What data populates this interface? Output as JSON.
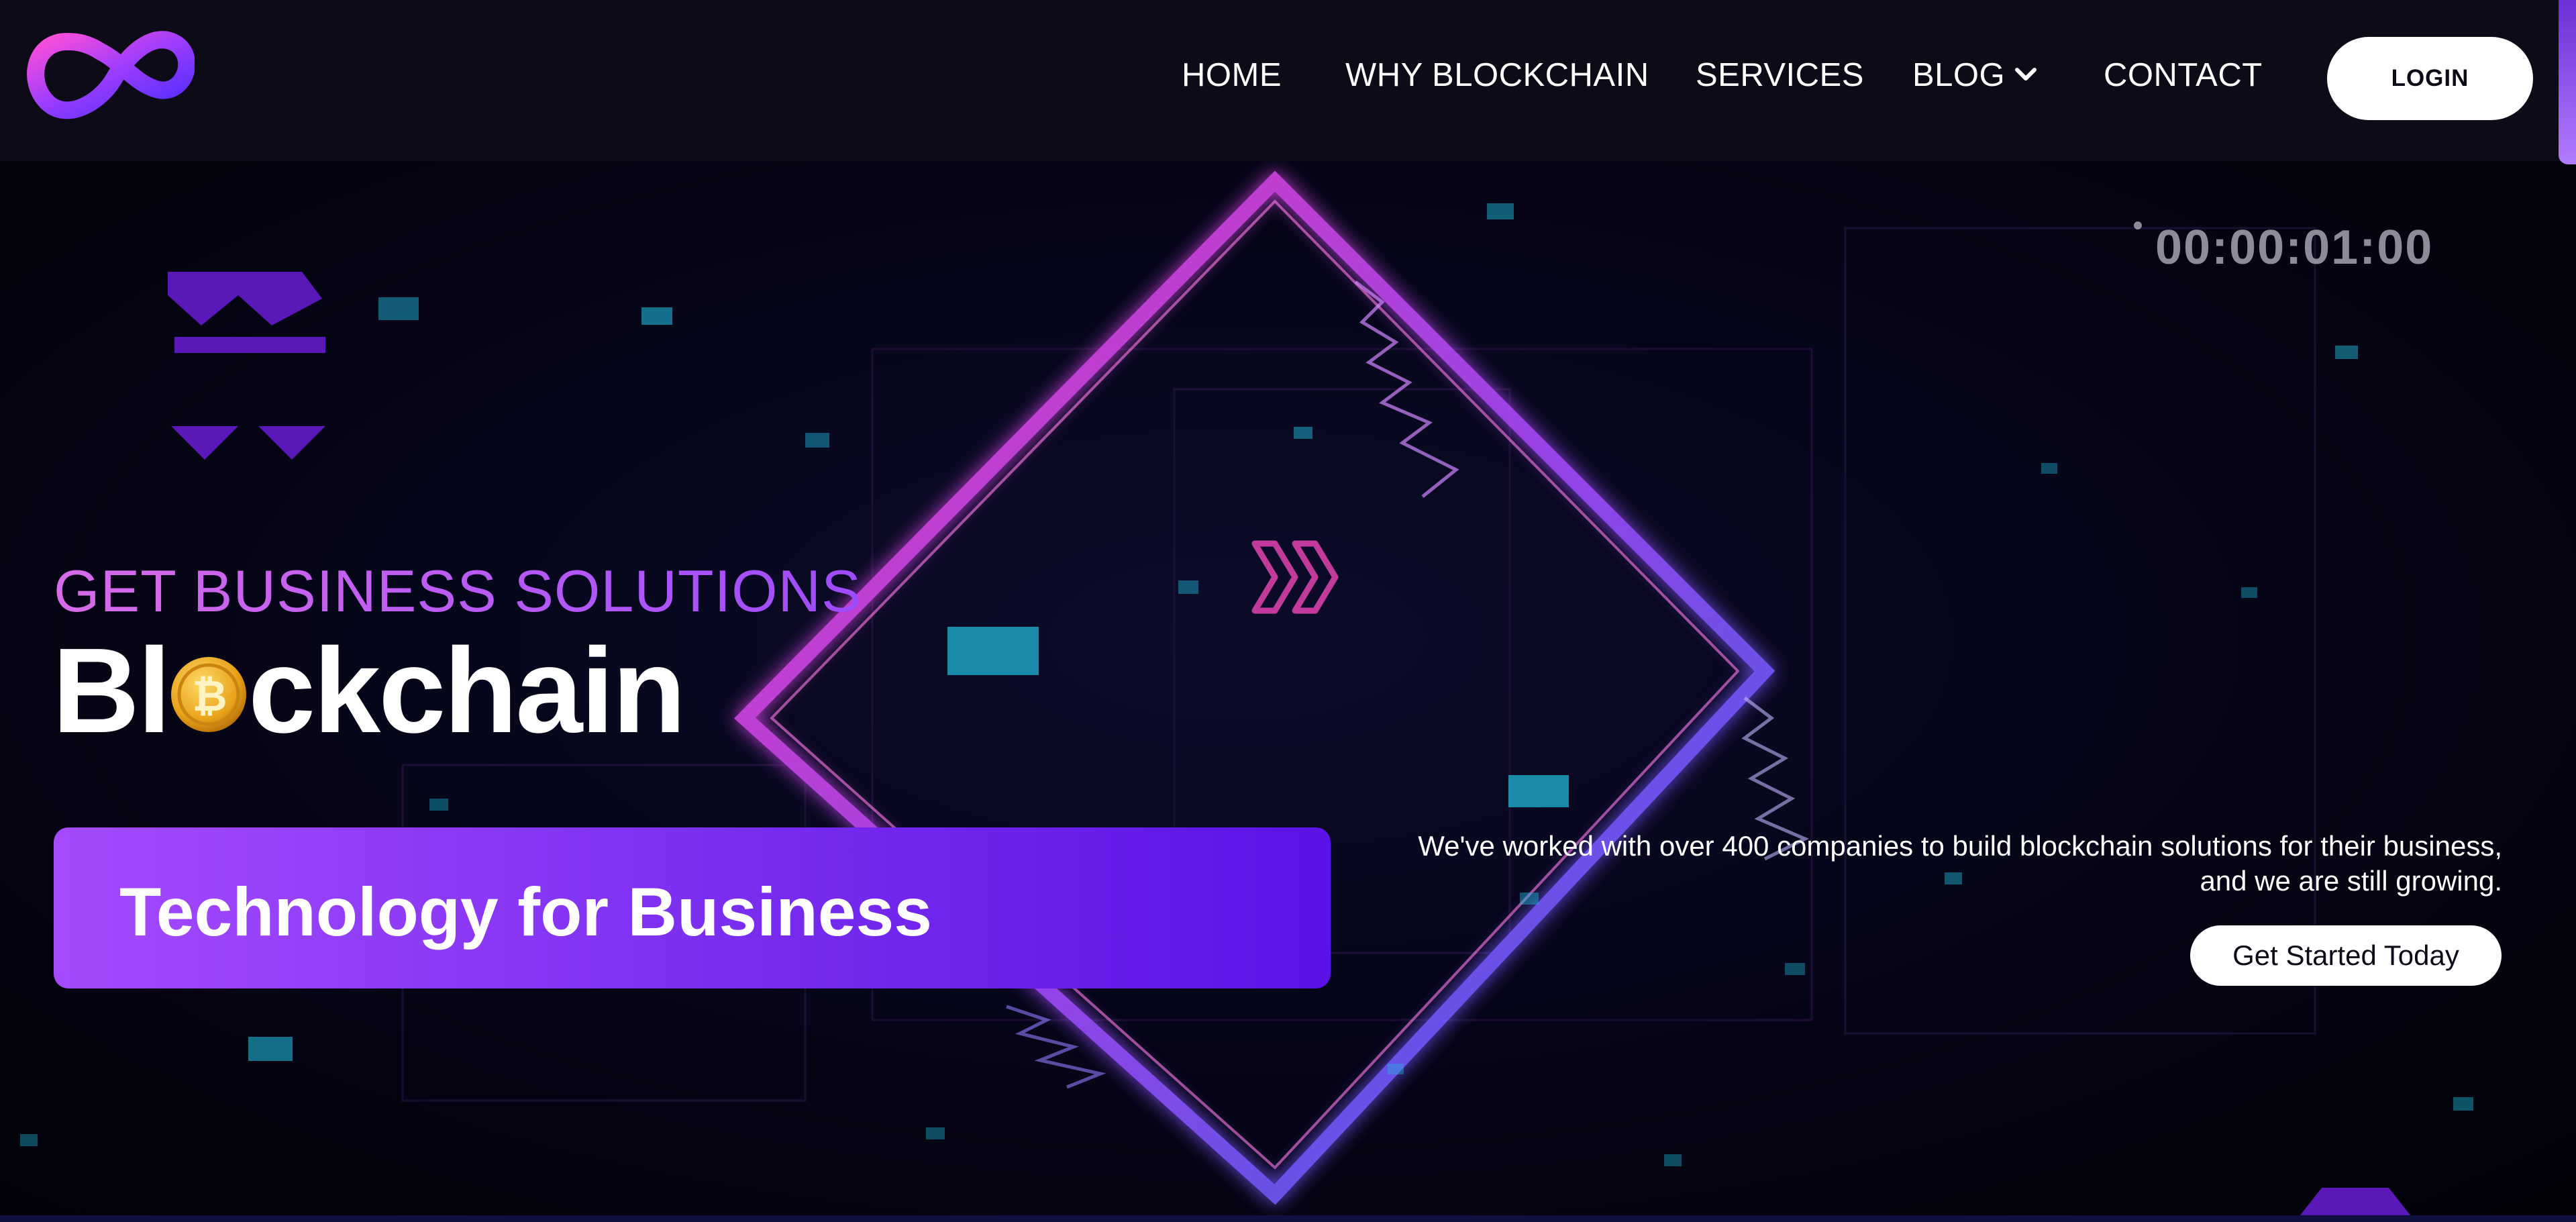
{
  "header": {
    "logo_icon": "infinity-logo-icon",
    "nav": {
      "home": "HOME",
      "why_blockchain": "WHY BLOCKCHAIN",
      "services": "SERVICES",
      "blog": "BLOG",
      "contact": "CONTACT"
    },
    "blog_dropdown_icon": "chevron-down-icon",
    "login_label": "LOGIN"
  },
  "hero": {
    "timecode": "00:00:01:00",
    "eyebrow": "GET BUSINESS SOLUTIONS",
    "headline_before": "Bl",
    "headline_after": "ckchain",
    "coin_icon": "bitcoin-coin-icon",
    "banner_text": "Technology for Business",
    "description_line1": "We've worked with over 400 companies to build blockchain solutions for their business,",
    "description_line2": "and we are still growing.",
    "cta_label": "Get Started Today"
  },
  "colors": {
    "header_bg": "#0c0b17",
    "accent_purple": "#7d2ff0",
    "neon_magenta": "#ff3fd0",
    "neon_blue": "#3f6bff",
    "particle_cyan": "#1fb6d6"
  }
}
